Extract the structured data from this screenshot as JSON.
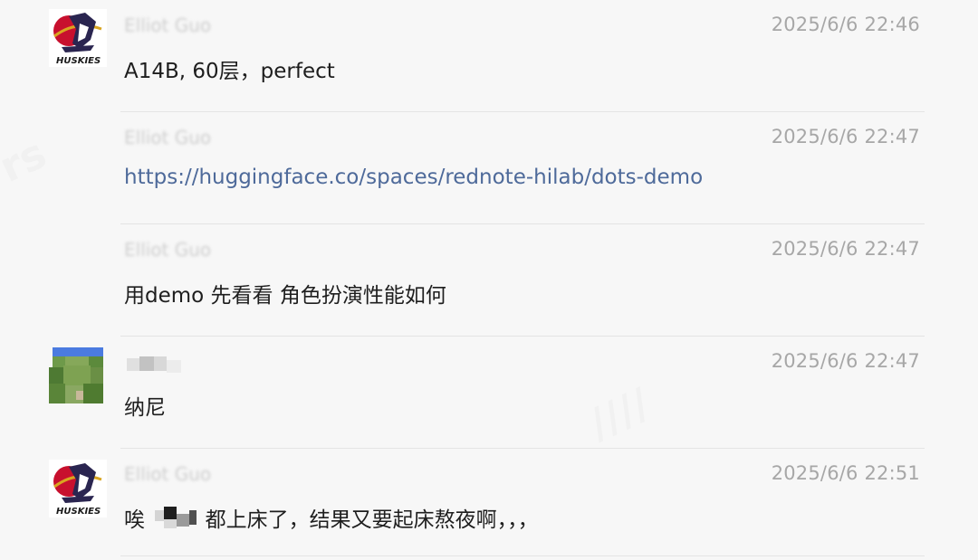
{
  "messages": [
    {
      "sender": "Elliot Guo",
      "time": "2025/6/6 22:46",
      "text": "A14B, 60层，perfect",
      "avatar": "huskies-logo",
      "show_avatar": true
    },
    {
      "sender": "Elliot Guo",
      "time": "2025/6/6 22:47",
      "text": "https://huggingface.co/spaces/rednote-hilab/dots-demo",
      "is_link": true,
      "show_avatar": false
    },
    {
      "sender": "Elliot Guo",
      "time": "2025/6/6 22:47",
      "text": "用demo 先看看 角色扮演性能如何",
      "show_avatar": false
    },
    {
      "sender": "",
      "time": "2025/6/6 22:47",
      "text": "纳尼",
      "avatar": "minecraft-grass-avatar",
      "show_avatar": true
    },
    {
      "sender": "Elliot Guo",
      "time": "2025/6/6 22:51",
      "text_before": "唉",
      "text_after": "都上床了，结果又要起床熬夜啊，，，",
      "avatar": "huskies-logo",
      "show_avatar": true
    }
  ],
  "avatar_logo_text": "HUSKIES",
  "colors": {
    "background": "#f7f7f7",
    "timestamp": "#a7a7a7",
    "link": "#4e6a9a",
    "separator": "#e4e4e4"
  }
}
